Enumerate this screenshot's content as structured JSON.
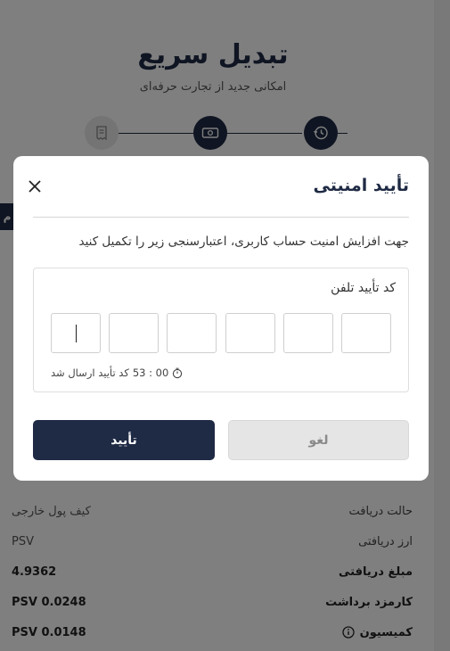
{
  "page": {
    "title": "تبدیل سریع",
    "subtitle": "امکانی جدید از تجارت حرفه‌ای",
    "left_tab_label": "م"
  },
  "stepper": {
    "steps": [
      {
        "icon": "receipt-icon",
        "state": "todo"
      },
      {
        "icon": "money-icon",
        "state": "done"
      },
      {
        "icon": "history-icon",
        "state": "done"
      }
    ]
  },
  "details": {
    "rows": [
      {
        "label": "حالت دریافت",
        "value": "کیف پول خارجی"
      },
      {
        "label": "ارز دریافتی",
        "value": "PSV"
      },
      {
        "label": "مبلغ دریافتی",
        "value": "4.9362"
      },
      {
        "label": "کارمزد برداشت",
        "value": "PSV 0.0248"
      },
      {
        "label": "کمیسیون",
        "value": "PSV 0.0148",
        "icon": "info-icon"
      }
    ]
  },
  "modal": {
    "title": "تأیید امنیتی",
    "description": "جهت افزایش امنیت حساب کاربری، اعتبارسنجی زیر را تکمیل کنید",
    "otp_label": "کد تأیید تلفن",
    "otp_digits": [
      "",
      "",
      "",
      "",
      "",
      ""
    ],
    "timer": "53 : 00",
    "status_text": "کد تأیید ارسال شد",
    "confirm_label": "تأیید",
    "cancel_label": "لغو"
  },
  "colors": {
    "primary": "#1f2a44",
    "overlay": "rgba(0,0,0,0.5)",
    "cancel_bg": "#e5e5e5"
  }
}
